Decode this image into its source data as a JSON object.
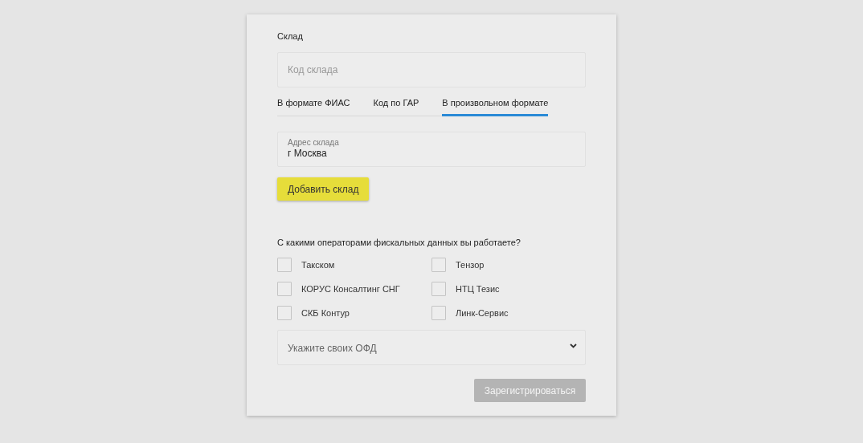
{
  "warehouse": {
    "label": "Склад",
    "code_field": {
      "placeholder": "Код склада"
    },
    "tabs": [
      {
        "label": "В формате ФИАС",
        "selected": false
      },
      {
        "label": "Код по ГАР",
        "selected": false
      },
      {
        "label": "В произвольном формате",
        "selected": true
      }
    ],
    "address_field": {
      "label": "Адрес склада",
      "value": "г Москва"
    },
    "add_button": "Добавить склад"
  },
  "ofd": {
    "question": "С какими операторами фискальных данных вы работаете?",
    "options": [
      {
        "label": "Такском",
        "checked": false
      },
      {
        "label": "Тензор",
        "checked": false
      },
      {
        "label": "КОРУС Консалтинг СНГ",
        "checked": false
      },
      {
        "label": "НТЦ Тезис",
        "checked": false
      },
      {
        "label": "СКБ Контур",
        "checked": false
      },
      {
        "label": "Линк-Сервис",
        "checked": false
      }
    ],
    "select": {
      "placeholder": "Укажите своих ОФД"
    }
  },
  "register_button": {
    "label": "Зарегистрироваться",
    "disabled": true
  }
}
